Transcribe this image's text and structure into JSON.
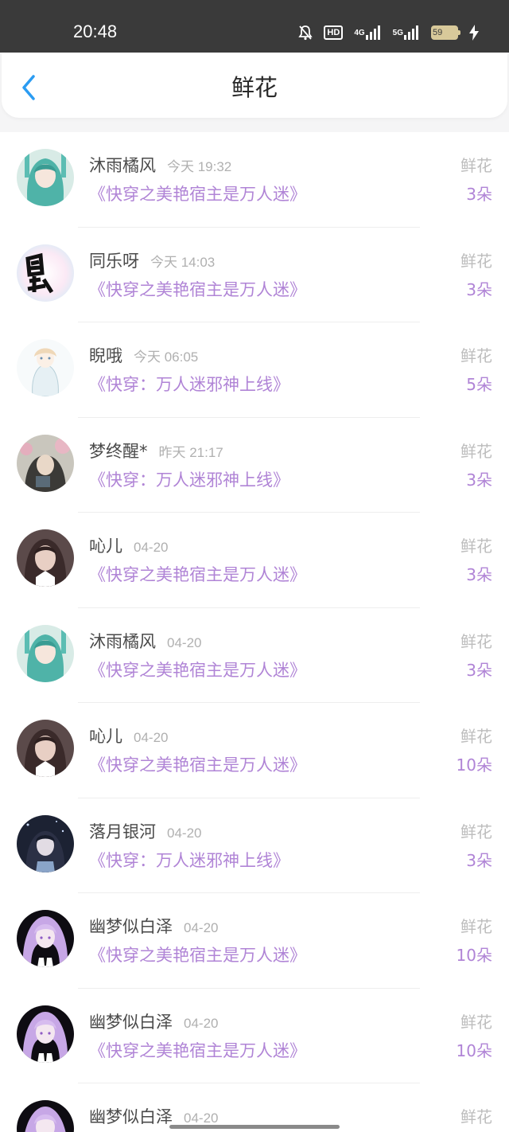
{
  "status_bar": {
    "time": "20:48",
    "hd": "HD",
    "net1": "4G",
    "net2": "5G",
    "battery": "59"
  },
  "header": {
    "title": "鲜花",
    "accent_color": "#2b9cf2"
  },
  "colors": {
    "book_title": "#b084d6",
    "label_gray": "#bdbdbd"
  },
  "items": [
    {
      "name": "沐雨橘风",
      "time": "今天 19:32",
      "book": "《快穿之美艳宿主是万人迷》",
      "type": "鲜花",
      "count": "3朵",
      "avatar": "teal-hair-avatar"
    },
    {
      "name": "同乐呀",
      "time": "今天 14:03",
      "book": "《快穿之美艳宿主是万人迷》",
      "type": "鲜花",
      "count": "3朵",
      "avatar": "calligraphy-avatar"
    },
    {
      "name": "睨哦",
      "time": "今天 06:05",
      "book": "《快穿：万人迷邪神上线》",
      "type": "鲜花",
      "count": "5朵",
      "avatar": "sketch-girl-avatar"
    },
    {
      "name": "梦终醒*",
      "time": "昨天 21:17",
      "book": "《快穿：万人迷邪神上线》",
      "type": "鲜花",
      "count": "3朵",
      "avatar": "flower-girl-avatar"
    },
    {
      "name": "吣儿",
      "time": "04-20",
      "book": "《快穿之美艳宿主是万人迷》",
      "type": "鲜花",
      "count": "3朵",
      "avatar": "dark-hair-girl-avatar"
    },
    {
      "name": "沐雨橘风",
      "time": "04-20",
      "book": "《快穿之美艳宿主是万人迷》",
      "type": "鲜花",
      "count": "3朵",
      "avatar": "teal-hair-avatar"
    },
    {
      "name": "吣儿",
      "time": "04-20",
      "book": "《快穿之美艳宿主是万人迷》",
      "type": "鲜花",
      "count": "10朵",
      "avatar": "dark-hair-girl-avatar"
    },
    {
      "name": "落月银河",
      "time": "04-20",
      "book": "《快穿：万人迷邪神上线》",
      "type": "鲜花",
      "count": "3朵",
      "avatar": "night-sky-avatar"
    },
    {
      "name": "幽梦似白泽",
      "time": "04-20",
      "book": "《快穿之美艳宿主是万人迷》",
      "type": "鲜花",
      "count": "10朵",
      "avatar": "purple-hair-avatar"
    },
    {
      "name": "幽梦似白泽",
      "time": "04-20",
      "book": "《快穿之美艳宿主是万人迷》",
      "type": "鲜花",
      "count": "10朵",
      "avatar": "purple-hair-avatar"
    },
    {
      "name": "幽梦似白泽",
      "time": "04-20",
      "book": "",
      "type": "鲜花",
      "count": "",
      "avatar": "purple-hair-avatar"
    }
  ]
}
